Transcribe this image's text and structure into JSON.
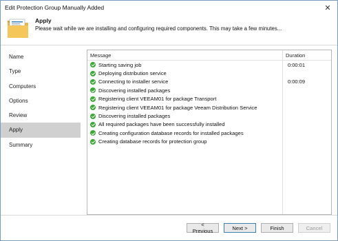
{
  "window": {
    "title": "Edit Protection Group Manually Added",
    "close_glyph": "✕"
  },
  "header": {
    "icon": "folder-icon",
    "title": "Apply",
    "subtitle": "Please wait while we are installing and configuring required components. This may take a few minutes..."
  },
  "nav": {
    "items": [
      {
        "label": "Name"
      },
      {
        "label": "Type"
      },
      {
        "label": "Computers"
      },
      {
        "label": "Options"
      },
      {
        "label": "Review"
      },
      {
        "label": "Apply"
      },
      {
        "label": "Summary"
      }
    ],
    "active": "Apply"
  },
  "log": {
    "columns": {
      "message": "Message",
      "duration": "Duration"
    },
    "rows": [
      {
        "message": "Starting saving job",
        "duration": "0:00:01"
      },
      {
        "message": "Deploying distribution service",
        "duration": ""
      },
      {
        "message": "Connecting to installer service",
        "duration": "0:00:09"
      },
      {
        "message": "Discovering installed packages",
        "duration": ""
      },
      {
        "message": "Registering client VEEAM01 for package Transport",
        "duration": ""
      },
      {
        "message": "Registering client VEEAM01 for package Veeam Distribution Service",
        "duration": ""
      },
      {
        "message": "Discovering installed packages",
        "duration": ""
      },
      {
        "message": "All required packages have been successfully installed",
        "duration": ""
      },
      {
        "message": "Creating configuration database records for installed packages",
        "duration": ""
      },
      {
        "message": "Creating database records for protection group",
        "duration": ""
      }
    ],
    "status_icon": "check-icon",
    "status_color": "#3aa935"
  },
  "buttons": {
    "previous": "< Previous",
    "next": "Next >",
    "finish": "Finish",
    "cancel": "Cancel"
  }
}
